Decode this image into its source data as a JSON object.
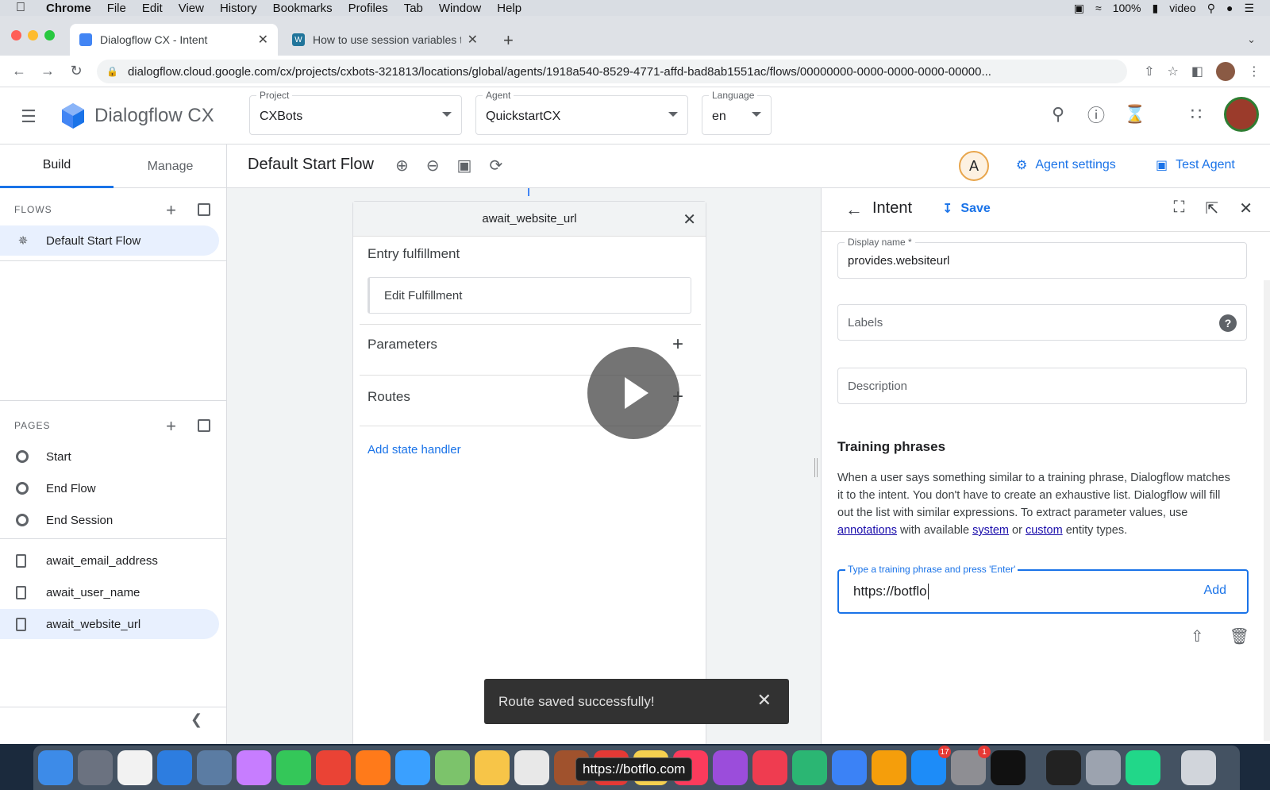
{
  "menubar": {
    "app": "Chrome",
    "items": [
      "File",
      "Edit",
      "View",
      "History",
      "Bookmarks",
      "Profiles",
      "Tab",
      "Window",
      "Help"
    ],
    "battery": "100%",
    "user": "video"
  },
  "browser": {
    "tabs": [
      {
        "label": "Dialogflow CX - Intent",
        "active": true
      },
      {
        "label": "How to use session variables t",
        "active": false
      }
    ],
    "url": "dialogflow.cloud.google.com/cx/projects/cxbots-321813/locations/global/agents/1918a540-8529-4771-affd-bad8ab1551ac/flows/00000000-0000-0000-0000-00000..."
  },
  "header": {
    "title": "Dialogflow CX",
    "project": {
      "label": "Project",
      "value": "CXBots"
    },
    "agent": {
      "label": "Agent",
      "value": "QuickstartCX"
    },
    "language": {
      "label": "Language",
      "value": "en"
    }
  },
  "sidebar": {
    "tabs": [
      "Build",
      "Manage"
    ],
    "flows_heading": "FLOWS",
    "flows": [
      "Default Start Flow"
    ],
    "pages_heading": "PAGES",
    "special_pages": [
      "Start",
      "End Flow",
      "End Session"
    ],
    "pages": [
      "await_email_address",
      "await_user_name",
      "await_website_url"
    ]
  },
  "flowbar": {
    "title": "Default Start Flow",
    "avatar_letter": "A",
    "agent_settings": "Agent settings",
    "test_agent": "Test Agent"
  },
  "node": {
    "title": "await_website_url",
    "entry_fulfillment": "Entry fulfillment",
    "edit_fulfillment": "Edit Fulfillment",
    "parameters": "Parameters",
    "routes": "Routes",
    "add_state_handler": "Add state handler"
  },
  "intent_panel": {
    "title": "Intent",
    "save": "Save",
    "display_name_label": "Display name *",
    "display_name_value": "provides.websiteurl",
    "labels_placeholder": "Labels",
    "description_placeholder": "Description",
    "training_title": "Training phrases",
    "training_desc_1": "When a user says something similar to a training phrase, Dialogflow matches it to the intent. You don't have to create an exhaustive list. Dialogflow will fill out the list with similar expressions. To extract parameter values, use ",
    "link_annotations": "annotations",
    "training_desc_2": " with available ",
    "link_system": "system",
    "training_desc_3": " or ",
    "link_custom": "custom",
    "training_desc_4": " entity types.",
    "phrase_input_label": "Type a training phrase and press 'Enter'",
    "phrase_input_value": "https://botflo",
    "add": "Add"
  },
  "snackbar": {
    "message": "Route saved successfully!"
  },
  "dock": {
    "tooltip": "https://botflo.com",
    "badges": [
      "17",
      "1"
    ]
  },
  "colors": {
    "accent": "#1a73e8",
    "selected_bg": "#e8f0fe",
    "snackbar_bg": "#323232"
  }
}
